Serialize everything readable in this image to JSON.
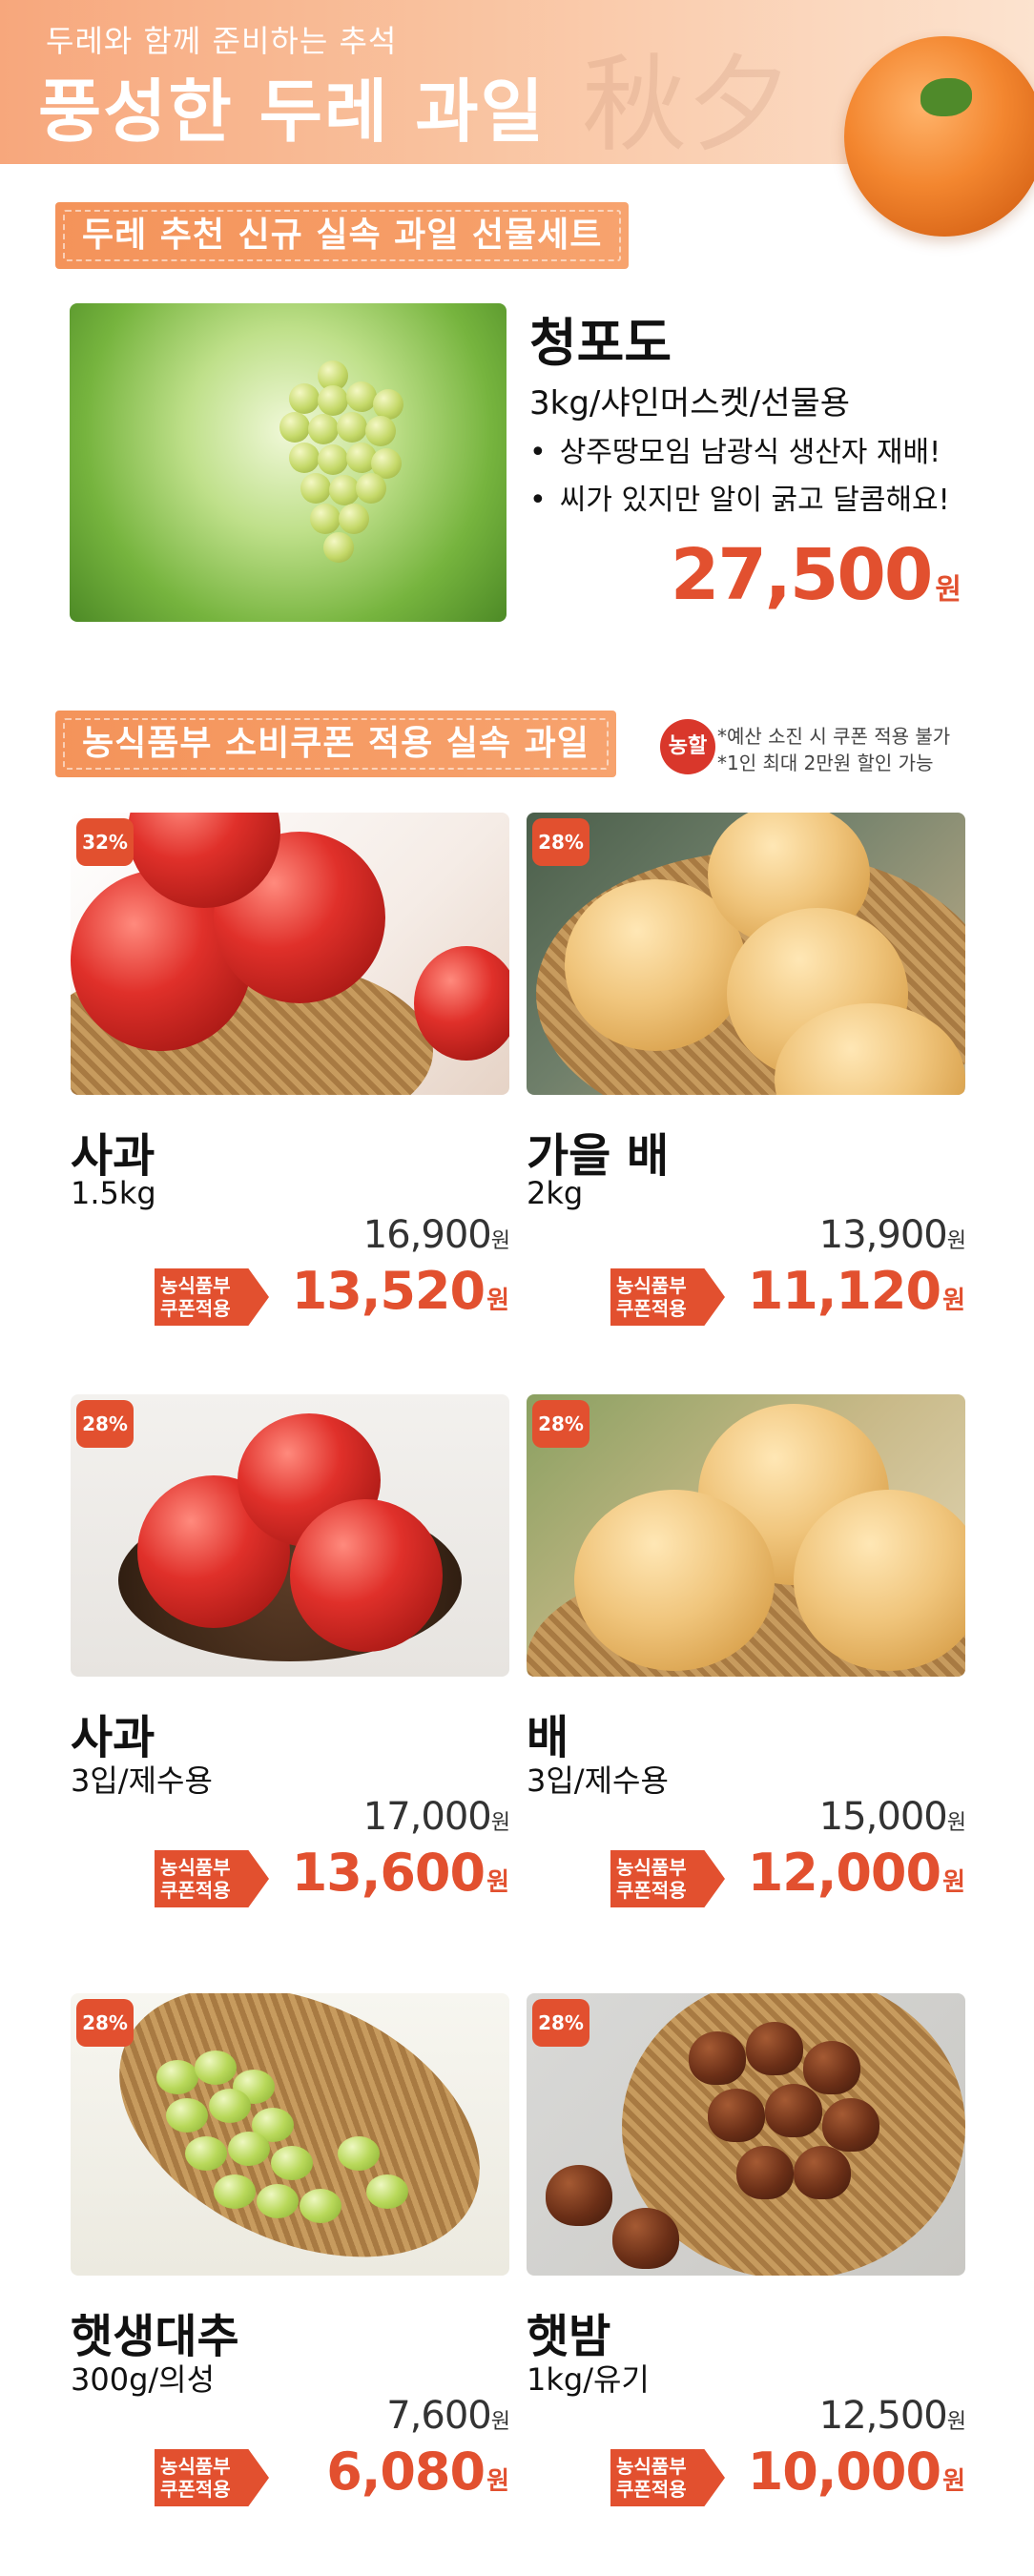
{
  "header": {
    "subtitle": "두레와 함께 준비하는 추석",
    "title": "풍성한 두레 과일",
    "deco": "秋夕"
  },
  "featured_section": {
    "banner": "두레 추천 신규 실속 과일 선물세트",
    "product": {
      "name": "청포도",
      "spec": "3kg/샤인머스켓/선물용",
      "bullets": [
        "상주땅모임 남광식 생산자 재배!",
        "씨가 있지만 알이 굵고 달콤해요!"
      ],
      "price": "27,500",
      "currency": "원"
    }
  },
  "coupon_section": {
    "banner": "농식품부 소비쿠폰 적용 실속 과일",
    "badge": "농할",
    "notes": [
      "*예산 소진 시 쿠폰 적용 불가",
      "*1인 최대 2만원 할인 가능"
    ],
    "tag_line1": "농식품부",
    "tag_line2": "쿠폰적용",
    "currency": "원",
    "products": [
      {
        "discount": "32%",
        "name": "사과",
        "spec": "1.5kg",
        "original": "16,900",
        "sale": "13,520"
      },
      {
        "discount": "28%",
        "name": "가을 배",
        "spec": "2kg",
        "original": "13,900",
        "sale": "11,120"
      },
      {
        "discount": "28%",
        "name": "사과",
        "spec": "3입/제수용",
        "original": "17,000",
        "sale": "13,600"
      },
      {
        "discount": "28%",
        "name": "배",
        "spec": "3입/제수용",
        "original": "15,000",
        "sale": "12,000"
      },
      {
        "discount": "28%",
        "name": "햇생대추",
        "spec": "300g/의성",
        "original": "7,600",
        "sale": "6,080"
      },
      {
        "discount": "28%",
        "name": "햇밤",
        "spec": "1kg/유기",
        "original": "12,500",
        "sale": "10,000"
      }
    ]
  },
  "colors": {
    "accent": "#e2502f",
    "banner": "#f4935a",
    "header_start": "#f7a77c"
  }
}
